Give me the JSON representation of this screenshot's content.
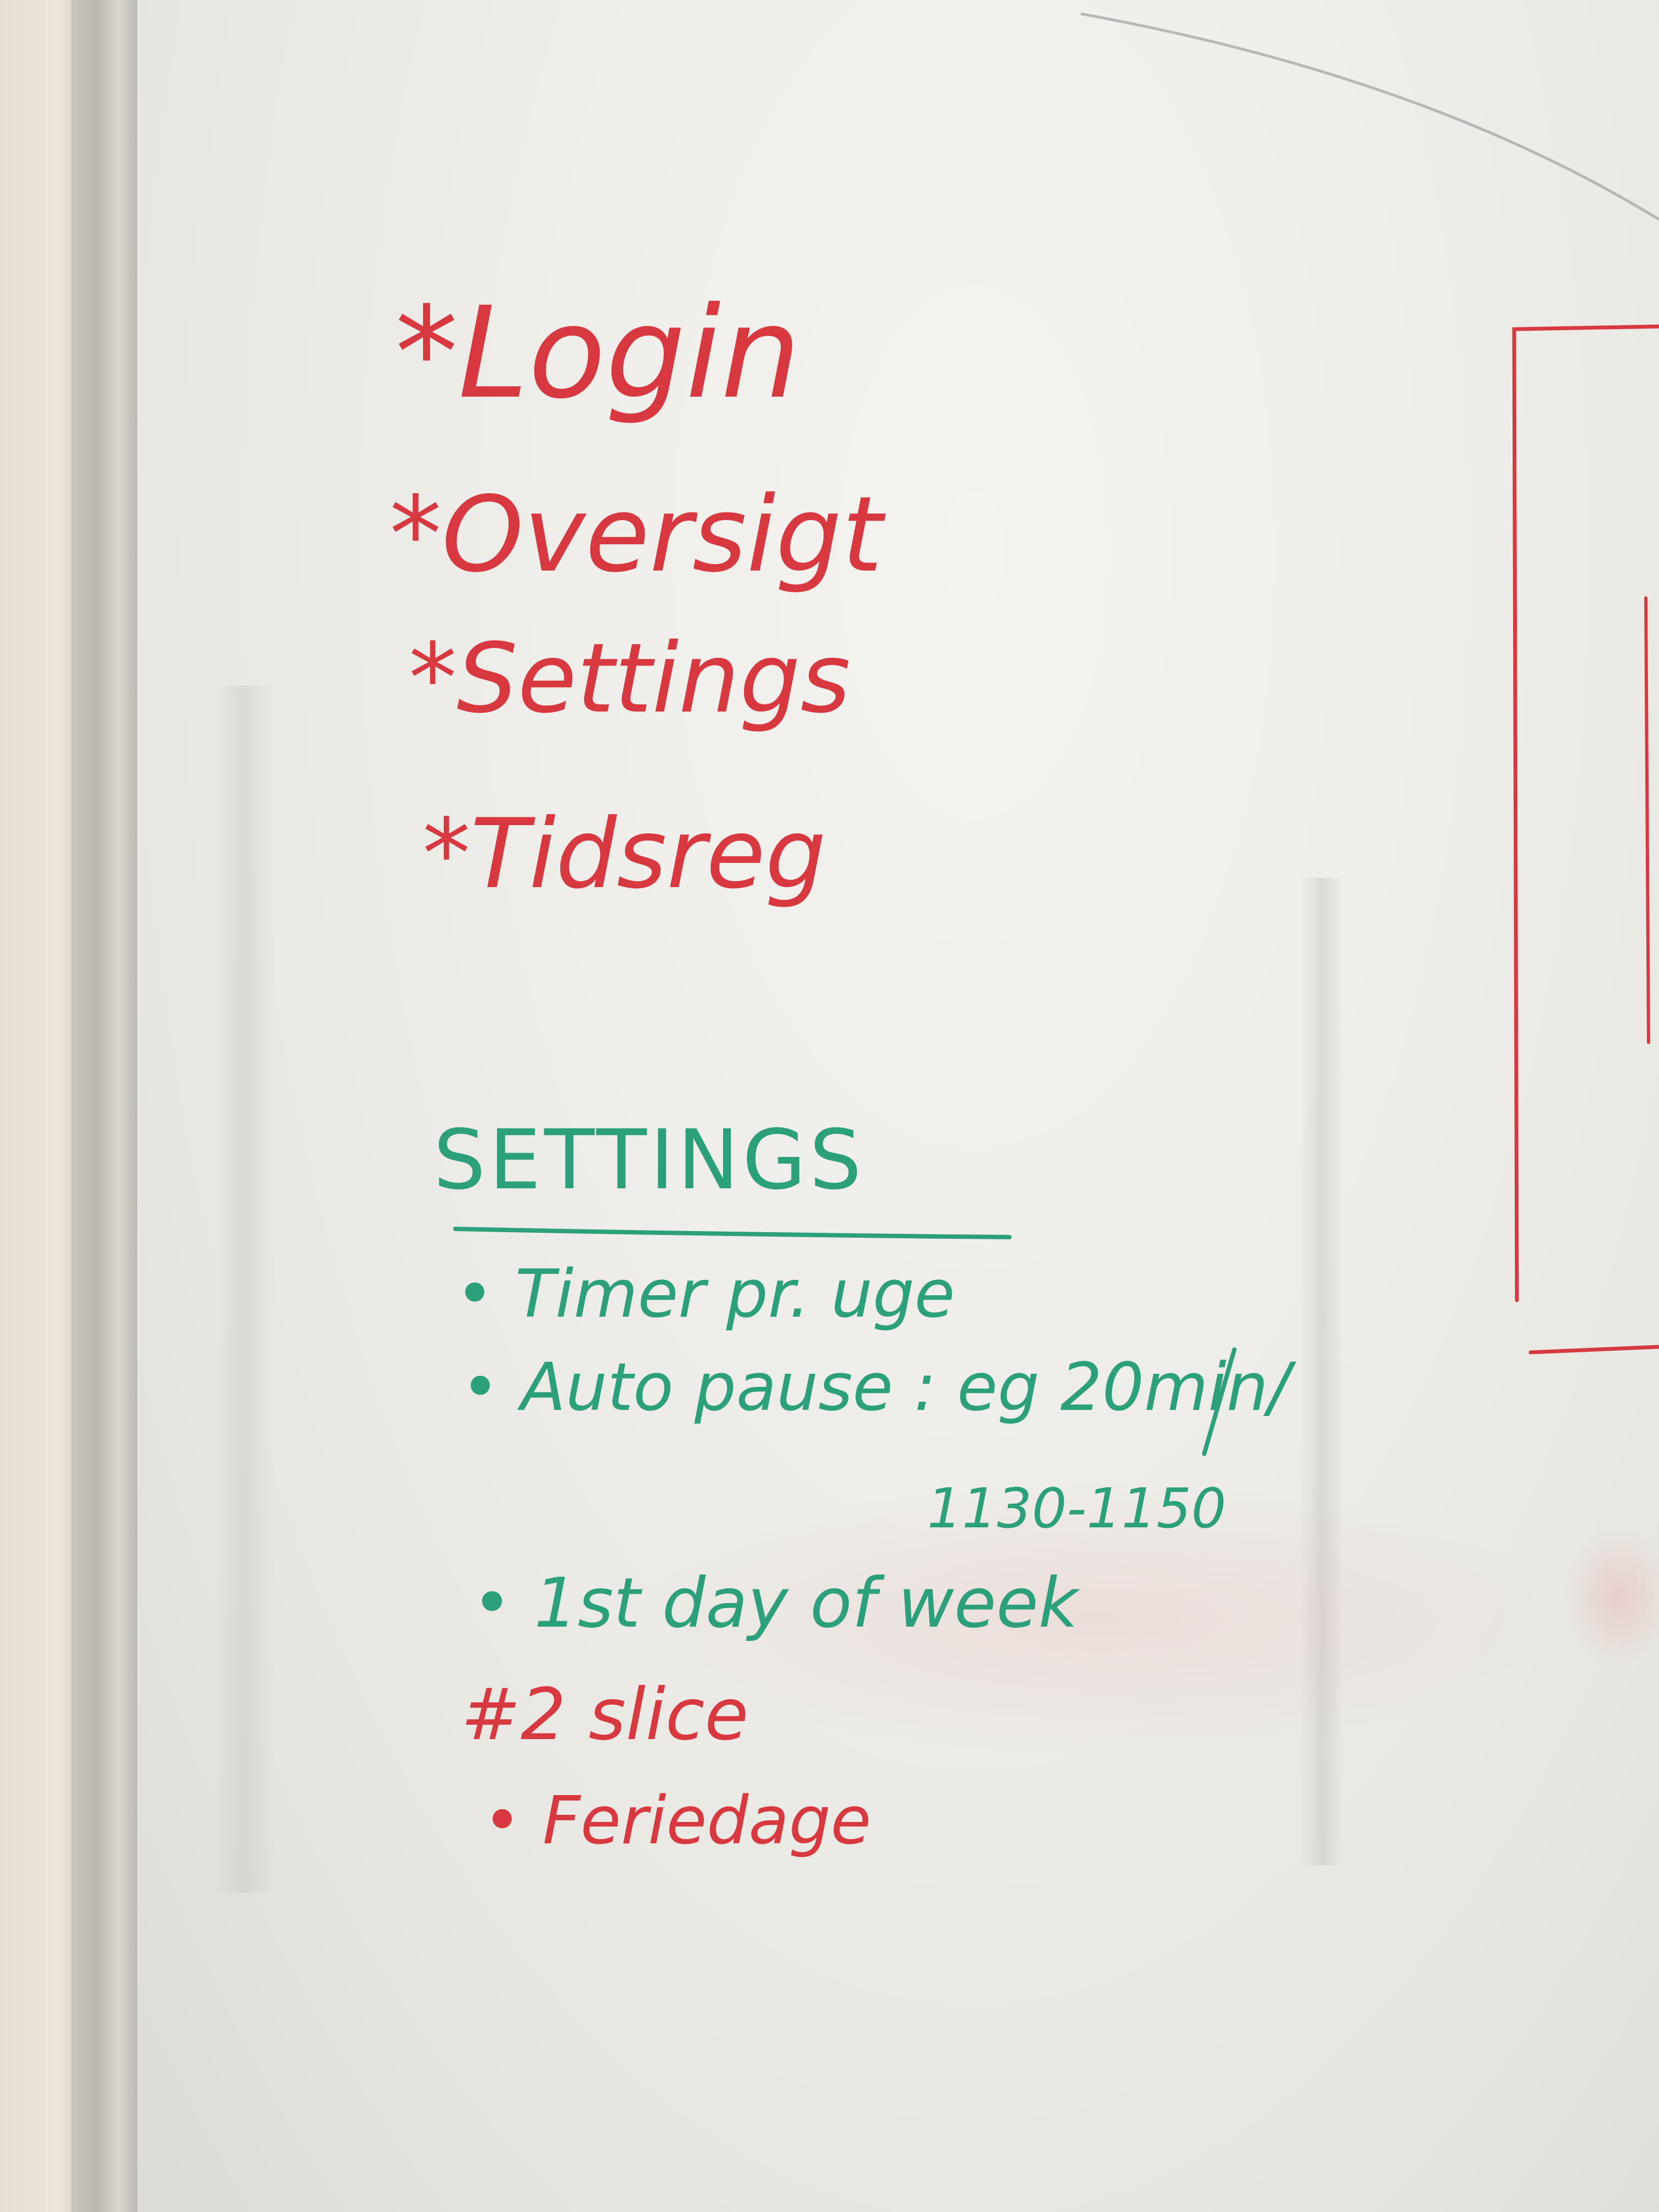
{
  "board": {
    "red_items": [
      {
        "bullet": "*",
        "label": "Login"
      },
      {
        "bullet": "*",
        "label": "Oversigt"
      },
      {
        "bullet": "*",
        "label": "Settings"
      },
      {
        "bullet": "*",
        "label": "Tidsreg"
      }
    ],
    "settings_heading": "SETTINGS",
    "settings_items": [
      {
        "bullet": "•",
        "label": "Timer pr. uge"
      },
      {
        "bullet": "•",
        "label": "Auto pause : eg 20min/"
      },
      {
        "bullet": "",
        "label": "1130-1150"
      },
      {
        "bullet": "•",
        "label": "1st day of week"
      }
    ],
    "slice_heading": "#2 slice",
    "slice_items": [
      {
        "bullet": "•",
        "label": "Feriedage"
      }
    ]
  },
  "colors": {
    "red_marker": "#d8383f",
    "green_marker": "#2ca07a",
    "board": "#efeeea"
  }
}
